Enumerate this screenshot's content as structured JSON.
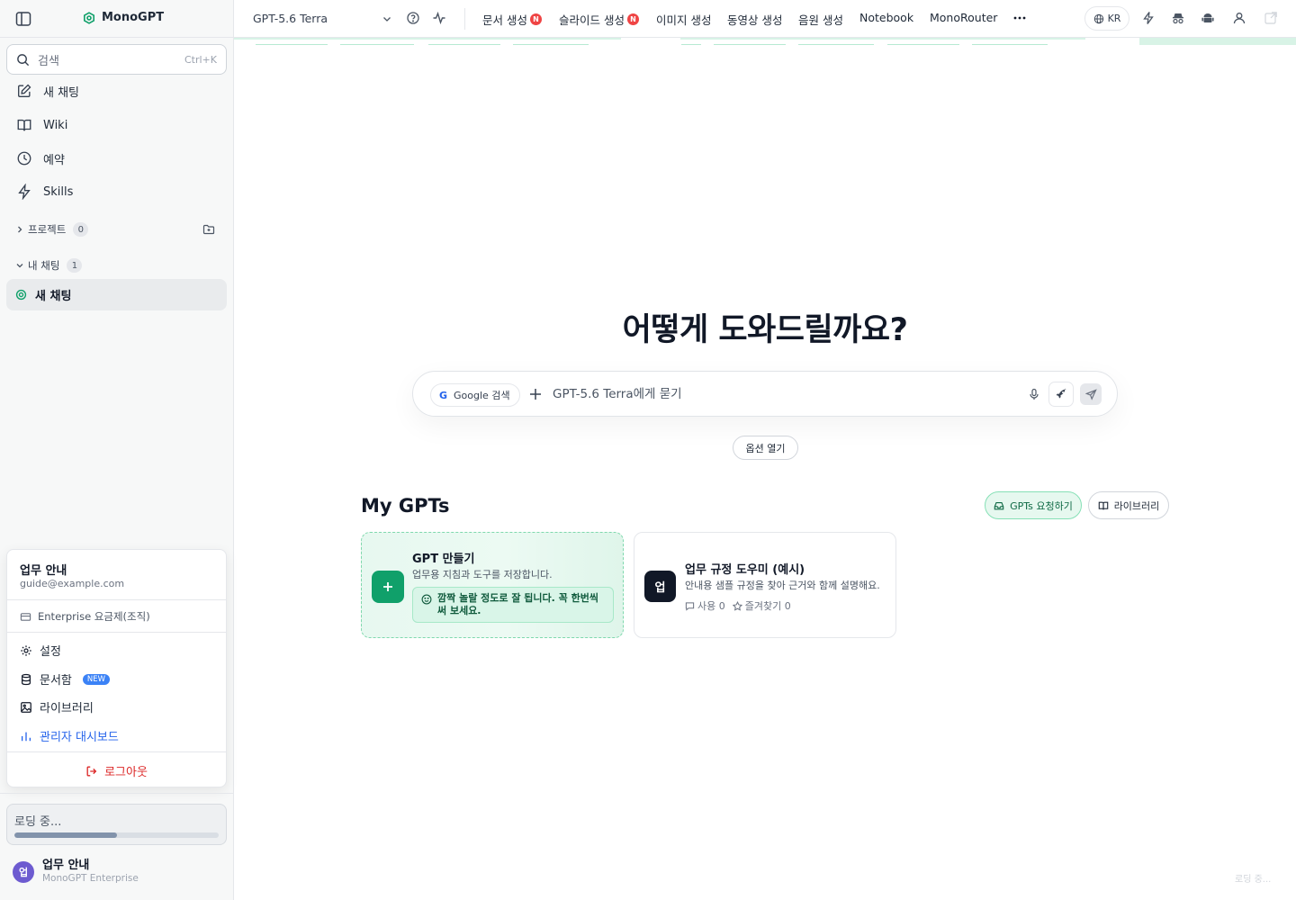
{
  "app": {
    "name": "MonoGPT"
  },
  "sidebar": {
    "search_placeholder": "검색",
    "search_shortcut": "Ctrl+K",
    "nav": [
      {
        "label": "새 채팅",
        "icon": "edit-icon"
      },
      {
        "label": "Wiki",
        "icon": "book-icon"
      },
      {
        "label": "예약",
        "icon": "clock-icon"
      },
      {
        "label": "Skills",
        "icon": "lightning-icon"
      }
    ],
    "projects": {
      "label": "프로젝트",
      "count": "0"
    },
    "my_chats": {
      "label": "내 채팅",
      "count": "1"
    },
    "chats": [
      {
        "label": "새 채팅"
      }
    ],
    "account_menu": {
      "name": "업무 안내",
      "email": "guide@example.com",
      "plan": "Enterprise 요금제(조직)",
      "items": [
        {
          "label": "설정",
          "icon": "gear-icon"
        },
        {
          "label": "문서함",
          "icon": "database-icon",
          "badge": "NEW"
        },
        {
          "label": "라이브러리",
          "icon": "image-icon"
        },
        {
          "label": "관리자 대시보드",
          "icon": "bar-chart-icon"
        }
      ],
      "logout": "로그아웃"
    },
    "loading": {
      "label": "로딩 중...",
      "progress": 0.5
    },
    "user": {
      "initial": "업",
      "name": "업무 안내",
      "plan": "MonoGPT Enterprise"
    }
  },
  "topbar": {
    "model": "GPT-5.6 Terra",
    "nav": [
      {
        "label": "문서 생성",
        "badge": "N"
      },
      {
        "label": "슬라이드 생성",
        "badge": "N"
      },
      {
        "label": "이미지 생성"
      },
      {
        "label": "동영상 생성"
      },
      {
        "label": "음원 생성"
      },
      {
        "label": "Notebook"
      },
      {
        "label": "MonoRouter"
      }
    ],
    "lang": "KR"
  },
  "main": {
    "hero": "어떻게 도와드릴까요?",
    "composer": {
      "google_search": "Google 검색",
      "google_mark": "G",
      "placeholder": "GPT-5.6 Terra에게 묻기"
    },
    "options": "옵션 열기",
    "my_gpts": {
      "title": "My GPTs",
      "request_button": "GPTs 요청하기",
      "library_button": "라이브러리",
      "create_card": {
        "title": "GPT 만들기",
        "desc": "업무용 지침과 도구를 저장합니다.",
        "tip": "깜짝 놀랄 정도로 잘 됩니다. 꼭 한번씩 써 보세요."
      },
      "gpts": [
        {
          "initial": "업",
          "title": "업무 규정 도우미 (예시)",
          "desc": "안내용 샘플 규정을 찾아 근거와 함께 설명해요.",
          "uses_label": "사용 0",
          "favs_label": "즐겨찾기 0"
        }
      ]
    },
    "footer_loading": "로딩 중..."
  },
  "colors": {
    "accent": "#10a06a",
    "danger": "#dc2626",
    "link": "#2563eb"
  }
}
